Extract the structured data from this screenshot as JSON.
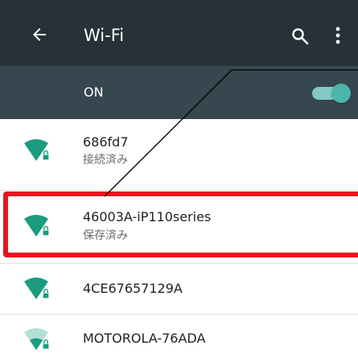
{
  "header": {
    "title": "Wi-Fi",
    "back_icon": "arrow-back-icon",
    "search_icon": "search-icon",
    "more_icon": "more-vert-icon"
  },
  "master_switch": {
    "label": "ON",
    "state": "on"
  },
  "networks": [
    {
      "ssid": "686fd7",
      "status": "接続済み",
      "secured": true,
      "signal": "full"
    },
    {
      "ssid": "46003A-iP110series",
      "status": "保存済み",
      "secured": true,
      "signal": "full"
    },
    {
      "ssid": "4CE67657129A",
      "status": "",
      "secured": true,
      "signal": "full"
    },
    {
      "ssid": "MOTOROLA-76ADA",
      "status": "",
      "secured": true,
      "signal": "weak"
    }
  ],
  "colors": {
    "appbar": "#263238",
    "switchbar": "#37474f",
    "accent": "#1b9b80",
    "highlight": "#e8141e"
  }
}
